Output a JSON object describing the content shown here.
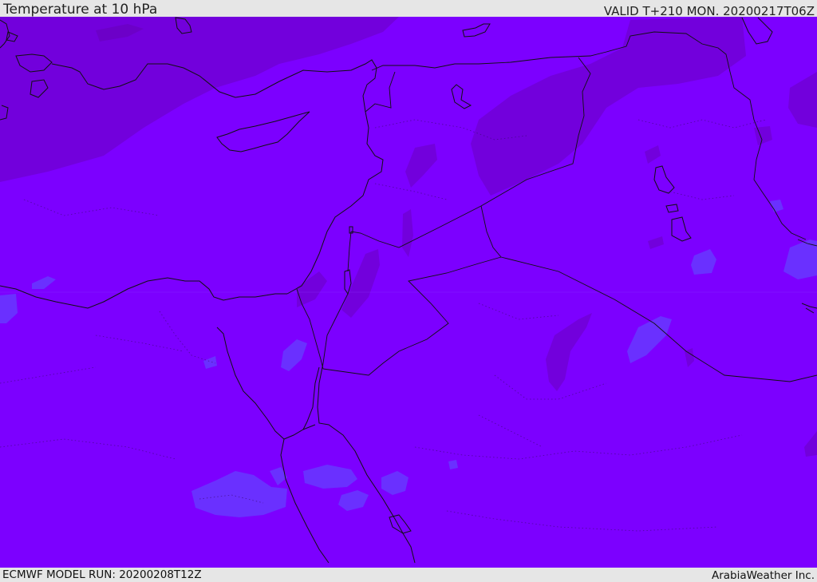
{
  "header": {
    "title": "Temperature at 10 hPa",
    "valid": "VALID T+210 MON. 20200217T06Z"
  },
  "footer": {
    "model_run": "ECMWF MODEL RUN: 20200208T12Z",
    "credit": "ArabiaWeather Inc."
  },
  "map": {
    "field": "temperature",
    "level": "10 hPa",
    "base_color": "#7c00ff",
    "warm_color": "#7400dc",
    "cool_color": "#6e2cff"
  }
}
